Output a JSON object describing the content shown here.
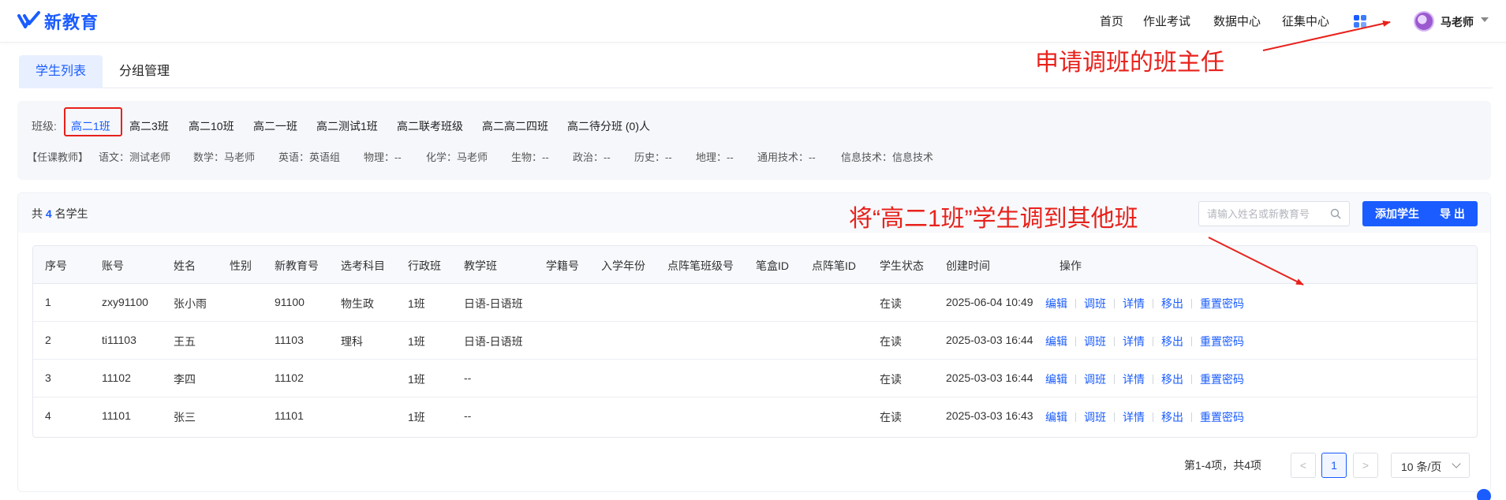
{
  "header": {
    "logo_text": "新教育",
    "nav": [
      "首页",
      "作业考试",
      "数据中心",
      "征集中心"
    ],
    "user_name": "马老师"
  },
  "tabs": [
    {
      "label": "学生列表",
      "active": true
    },
    {
      "label": "分组管理",
      "active": false
    }
  ],
  "classes": {
    "label": "班级:",
    "items": [
      "高二1班",
      "高二3班",
      "高二10班",
      "高二一班",
      "高二测试1班",
      "高二联考班级",
      "高二高二四班",
      "高二待分班 (0)人"
    ],
    "selected": "高二1班"
  },
  "teachers": {
    "label": "【任课教师】",
    "entries": [
      "语文：测试老师",
      "数学：马老师",
      "英语：英语组",
      "物理：--",
      "化学：马老师",
      "生物：--",
      "政治：--",
      "历史：--",
      "地理：--",
      "通用技术：--",
      "信息技术：信息技术"
    ]
  },
  "students": {
    "count_prefix": "共",
    "count": "4",
    "count_suffix": "名学生",
    "search_placeholder": "请输入姓名或新教育号",
    "add_label": "添加学生",
    "export_label": "导 出",
    "columns": [
      "序号",
      "账号",
      "姓名",
      "性别",
      "新教育号",
      "选考科目",
      "行政班",
      "教学班",
      "学籍号",
      "入学年份",
      "点阵笔班级号",
      "笔盒ID",
      "点阵笔ID",
      "学生状态",
      "创建时间",
      "操作"
    ],
    "rows": [
      {
        "no": "1",
        "account": "zxy91100",
        "name": "张小雨",
        "gender": "",
        "edu_id": "91100",
        "subjects": "物生政",
        "admin_class": "1班",
        "teach_class": "日语-日语班",
        "status": "在读",
        "created": "2025-06-04 10:49"
      },
      {
        "no": "2",
        "account": "ti11103",
        "name": "王五",
        "gender": "",
        "edu_id": "11103",
        "subjects": "理科",
        "admin_class": "1班",
        "teach_class": "日语-日语班",
        "status": "在读",
        "created": "2025-03-03 16:44"
      },
      {
        "no": "3",
        "account": "11102",
        "name": "李四",
        "gender": "",
        "edu_id": "11102",
        "subjects": "",
        "admin_class": "1班",
        "teach_class": "--",
        "status": "在读",
        "created": "2025-03-03 16:44"
      },
      {
        "no": "4",
        "account": "11101",
        "name": "张三",
        "gender": "",
        "edu_id": "11101",
        "subjects": "",
        "admin_class": "1班",
        "teach_class": "--",
        "status": "在读",
        "created": "2025-03-03 16:43"
      }
    ],
    "ops": [
      "编辑",
      "调班",
      "详情",
      "移出",
      "重置密码"
    ]
  },
  "pagination": {
    "summary": "第1-4项，共4项",
    "prev": "<",
    "current": "1",
    "next": ">",
    "page_size": "10 条/页"
  },
  "annotations": {
    "class_teacher_note": "申请调班的班主任",
    "transfer_note": "将“高二1班”学生调到其他班"
  },
  "colors": {
    "accent": "#1a5cff",
    "annotation_red": "#e8211b"
  }
}
